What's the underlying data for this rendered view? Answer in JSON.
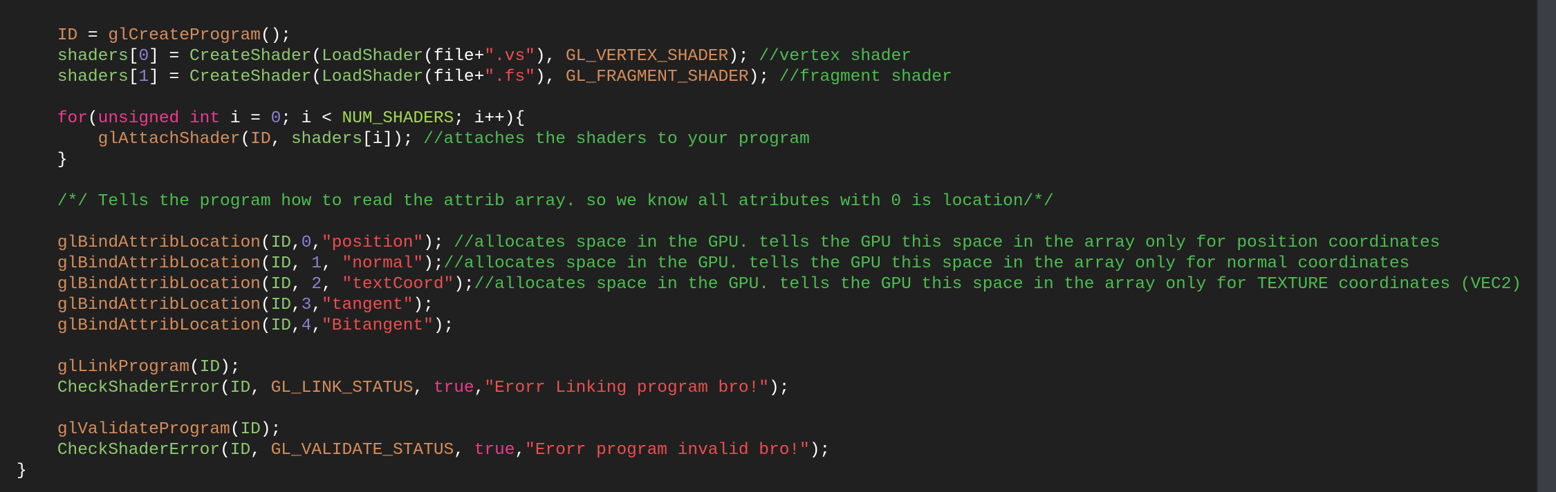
{
  "editor": {
    "theme_colors": {
      "background": "#202020",
      "plain": "#ffffff",
      "keyword": "#f2388d",
      "function": "#d68d5b",
      "project_identifier": "#8dc96f",
      "number": "#8b80d4",
      "string": "#ee4d4f",
      "comment": "#4cbd4f",
      "macro": "#a3d657"
    },
    "lines": [
      [],
      [],
      [
        {
          "t": "w",
          "text": "    "
        },
        {
          "t": "f",
          "text": "ID"
        },
        {
          "t": "w",
          "text": " = "
        },
        {
          "t": "f",
          "text": "glCreateProgram"
        },
        {
          "t": "w",
          "text": "();"
        }
      ],
      [
        {
          "t": "w",
          "text": "    "
        },
        {
          "t": "p",
          "text": "shaders"
        },
        {
          "t": "w",
          "text": "["
        },
        {
          "t": "n",
          "text": "0"
        },
        {
          "t": "w",
          "text": "] = "
        },
        {
          "t": "p",
          "text": "CreateShader"
        },
        {
          "t": "w",
          "text": "("
        },
        {
          "t": "p",
          "text": "LoadShader"
        },
        {
          "t": "w",
          "text": "(file+"
        },
        {
          "t": "s",
          "text": "\".vs\""
        },
        {
          "t": "w",
          "text": "), "
        },
        {
          "t": "f",
          "text": "GL_VERTEX_SHADER"
        },
        {
          "t": "w",
          "text": "); "
        },
        {
          "t": "c",
          "text": "//vertex shader"
        }
      ],
      [
        {
          "t": "w",
          "text": "    "
        },
        {
          "t": "p",
          "text": "shaders"
        },
        {
          "t": "w",
          "text": "["
        },
        {
          "t": "n",
          "text": "1"
        },
        {
          "t": "w",
          "text": "] = "
        },
        {
          "t": "p",
          "text": "CreateShader"
        },
        {
          "t": "w",
          "text": "("
        },
        {
          "t": "p",
          "text": "LoadShader"
        },
        {
          "t": "w",
          "text": "(file+"
        },
        {
          "t": "s",
          "text": "\".fs\""
        },
        {
          "t": "w",
          "text": "), "
        },
        {
          "t": "f",
          "text": "GL_FRAGMENT_SHADER"
        },
        {
          "t": "w",
          "text": "); "
        },
        {
          "t": "c",
          "text": "//fragment shader"
        }
      ],
      [],
      [
        {
          "t": "w",
          "text": "    "
        },
        {
          "t": "k",
          "text": "for"
        },
        {
          "t": "w",
          "text": "("
        },
        {
          "t": "k",
          "text": "unsigned int"
        },
        {
          "t": "w",
          "text": " i = "
        },
        {
          "t": "n",
          "text": "0"
        },
        {
          "t": "w",
          "text": "; i < "
        },
        {
          "t": "m",
          "text": "NUM_SHADERS"
        },
        {
          "t": "w",
          "text": "; i++){"
        }
      ],
      [
        {
          "t": "w",
          "text": "        "
        },
        {
          "t": "f",
          "text": "glAttachShader"
        },
        {
          "t": "w",
          "text": "("
        },
        {
          "t": "f",
          "text": "ID"
        },
        {
          "t": "w",
          "text": ", "
        },
        {
          "t": "p",
          "text": "shaders"
        },
        {
          "t": "w",
          "text": "[i]); "
        },
        {
          "t": "c",
          "text": "//attaches the shaders to your program"
        }
      ],
      [
        {
          "t": "w",
          "text": "    }"
        }
      ],
      [],
      [
        {
          "t": "w",
          "text": "    "
        },
        {
          "t": "c",
          "text": "/*/ Tells the program how to read the attrib array. so we know all atributes with 0 is location/*/"
        }
      ],
      [],
      [
        {
          "t": "w",
          "text": "    "
        },
        {
          "t": "f",
          "text": "glBindAttribLocation"
        },
        {
          "t": "w",
          "text": "("
        },
        {
          "t": "p",
          "text": "ID"
        },
        {
          "t": "w",
          "text": ","
        },
        {
          "t": "n",
          "text": "0"
        },
        {
          "t": "w",
          "text": ","
        },
        {
          "t": "s",
          "text": "\"position\""
        },
        {
          "t": "w",
          "text": "); "
        },
        {
          "t": "c",
          "text": "//allocates space in the GPU. tells the GPU this space in the array only for position coordinates"
        }
      ],
      [
        {
          "t": "w",
          "text": "    "
        },
        {
          "t": "f",
          "text": "glBindAttribLocation"
        },
        {
          "t": "w",
          "text": "("
        },
        {
          "t": "p",
          "text": "ID"
        },
        {
          "t": "w",
          "text": ", "
        },
        {
          "t": "n",
          "text": "1"
        },
        {
          "t": "w",
          "text": ", "
        },
        {
          "t": "s",
          "text": "\"normal\""
        },
        {
          "t": "w",
          "text": ");"
        },
        {
          "t": "c",
          "text": "//allocates space in the GPU. tells the GPU this space in the array only for normal coordinates"
        }
      ],
      [
        {
          "t": "w",
          "text": "    "
        },
        {
          "t": "f",
          "text": "glBindAttribLocation"
        },
        {
          "t": "w",
          "text": "("
        },
        {
          "t": "p",
          "text": "ID"
        },
        {
          "t": "w",
          "text": ", "
        },
        {
          "t": "n",
          "text": "2"
        },
        {
          "t": "w",
          "text": ", "
        },
        {
          "t": "s",
          "text": "\"textCoord\""
        },
        {
          "t": "w",
          "text": ");"
        },
        {
          "t": "c",
          "text": "//allocates space in the GPU. tells the GPU this space in the array only for TEXTURE coordinates (VEC2)"
        }
      ],
      [
        {
          "t": "w",
          "text": "    "
        },
        {
          "t": "f",
          "text": "glBindAttribLocation"
        },
        {
          "t": "w",
          "text": "("
        },
        {
          "t": "p",
          "text": "ID"
        },
        {
          "t": "w",
          "text": ","
        },
        {
          "t": "n",
          "text": "3"
        },
        {
          "t": "w",
          "text": ","
        },
        {
          "t": "s",
          "text": "\"tangent\""
        },
        {
          "t": "w",
          "text": ");"
        }
      ],
      [
        {
          "t": "w",
          "text": "    "
        },
        {
          "t": "f",
          "text": "glBindAttribLocation"
        },
        {
          "t": "w",
          "text": "("
        },
        {
          "t": "p",
          "text": "ID"
        },
        {
          "t": "w",
          "text": ","
        },
        {
          "t": "n",
          "text": "4"
        },
        {
          "t": "w",
          "text": ","
        },
        {
          "t": "s",
          "text": "\"Bitangent\""
        },
        {
          "t": "w",
          "text": ");"
        }
      ],
      [],
      [
        {
          "t": "w",
          "text": "    "
        },
        {
          "t": "f",
          "text": "glLinkProgram"
        },
        {
          "t": "w",
          "text": "("
        },
        {
          "t": "p",
          "text": "ID"
        },
        {
          "t": "w",
          "text": ");"
        }
      ],
      [
        {
          "t": "w",
          "text": "    "
        },
        {
          "t": "p",
          "text": "CheckShaderError"
        },
        {
          "t": "w",
          "text": "("
        },
        {
          "t": "p",
          "text": "ID"
        },
        {
          "t": "w",
          "text": ", "
        },
        {
          "t": "f",
          "text": "GL_LINK_STATUS"
        },
        {
          "t": "w",
          "text": ", "
        },
        {
          "t": "k",
          "text": "true"
        },
        {
          "t": "w",
          "text": ","
        },
        {
          "t": "s",
          "text": "\"Erorr Linking program bro!\""
        },
        {
          "t": "w",
          "text": ");"
        }
      ],
      [],
      [
        {
          "t": "w",
          "text": "    "
        },
        {
          "t": "f",
          "text": "glValidateProgram"
        },
        {
          "t": "w",
          "text": "("
        },
        {
          "t": "p",
          "text": "ID"
        },
        {
          "t": "w",
          "text": ");"
        }
      ],
      [
        {
          "t": "w",
          "text": "    "
        },
        {
          "t": "p",
          "text": "CheckShaderError"
        },
        {
          "t": "w",
          "text": "("
        },
        {
          "t": "p",
          "text": "ID"
        },
        {
          "t": "w",
          "text": ", "
        },
        {
          "t": "f",
          "text": "GL_VALIDATE_STATUS"
        },
        {
          "t": "w",
          "text": ", "
        },
        {
          "t": "k",
          "text": "true"
        },
        {
          "t": "w",
          "text": ","
        },
        {
          "t": "s",
          "text": "\"Erorr program invalid bro!\""
        },
        {
          "t": "w",
          "text": ");"
        }
      ],
      [
        {
          "t": "w",
          "text": "}"
        }
      ]
    ]
  }
}
